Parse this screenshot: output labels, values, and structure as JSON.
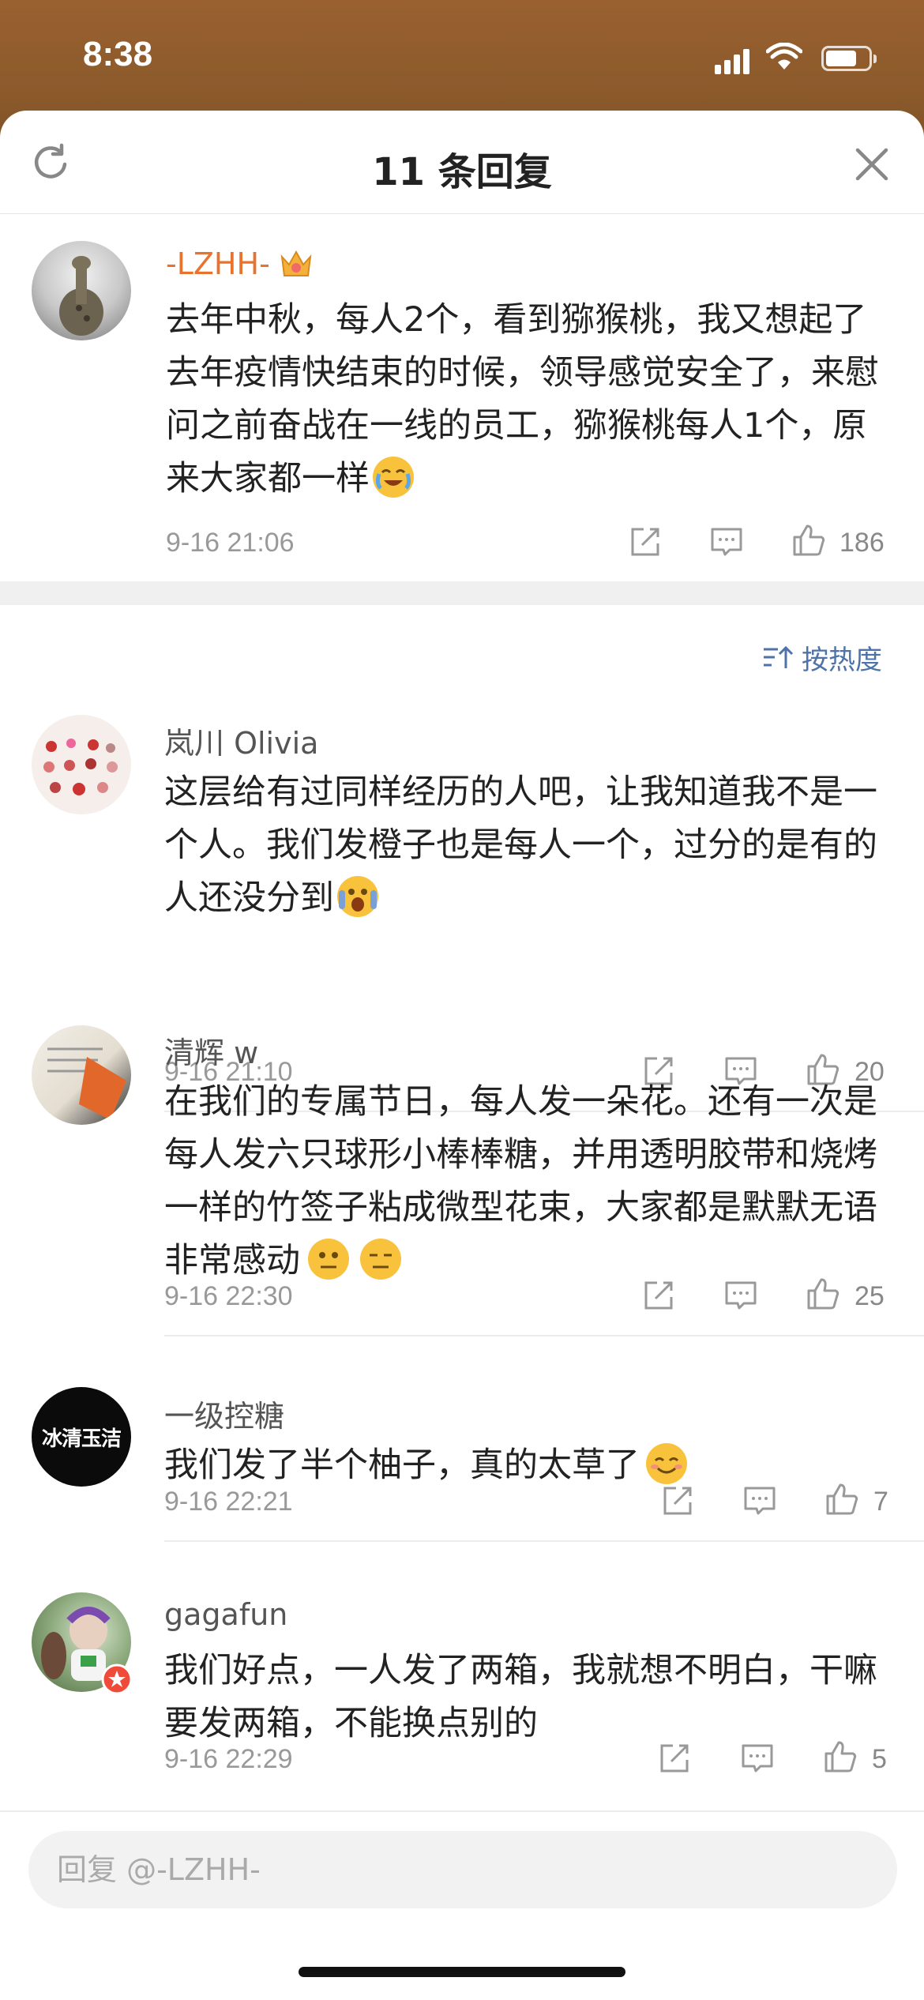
{
  "status_bar": {
    "time": "8:38"
  },
  "header": {
    "title": "11 条回复"
  },
  "main_comment": {
    "username": "-LZHH-",
    "text": "去年中秋，每人2个，看到猕猴桃，我又想起了去年疫情快结束的时候，领导感觉安全了，来慰问之前奋战在一线的员工，猕猴桃每人1个，原来大家都一样",
    "timestamp": "9-16 21:06",
    "likes": "186"
  },
  "sort": {
    "label": "按热度"
  },
  "replies": [
    {
      "username": "岚川 Olivia",
      "text": "这层给有过同样经历的人吧，让我知道我不是一个人。我们发橙子也是每人一个，过分的是有的人还没分到",
      "timestamp": "9-16 21:10",
      "likes": "20"
    },
    {
      "username": "清辉 w",
      "text": "在我们的专属节日，每人发一朵花。还有一次是每人发六只球形小棒棒糖，并用透明胶带和烧烤一样的竹签子粘成微型花束，大家都是默默无语非常感动",
      "timestamp": "9-16 22:30",
      "likes": "25"
    },
    {
      "username": "一级控糖",
      "avatar_text": "冰清玉洁",
      "text": "我们发了半个柚子，真的太草了",
      "timestamp": "9-16 22:21",
      "likes": "7"
    },
    {
      "username": "gagafun",
      "text": "我们好点，一人发了两箱，我就想不明白，干嘛要发两箱，不能换点别的",
      "timestamp": "9-16 22:29",
      "likes": "5"
    }
  ],
  "reply_input": {
    "placeholder": "回复 @-LZHH-"
  },
  "colors": {
    "username_highlight": "#e8732e",
    "link_blue": "#4d73a8",
    "topbar": "#8b5a2b"
  }
}
